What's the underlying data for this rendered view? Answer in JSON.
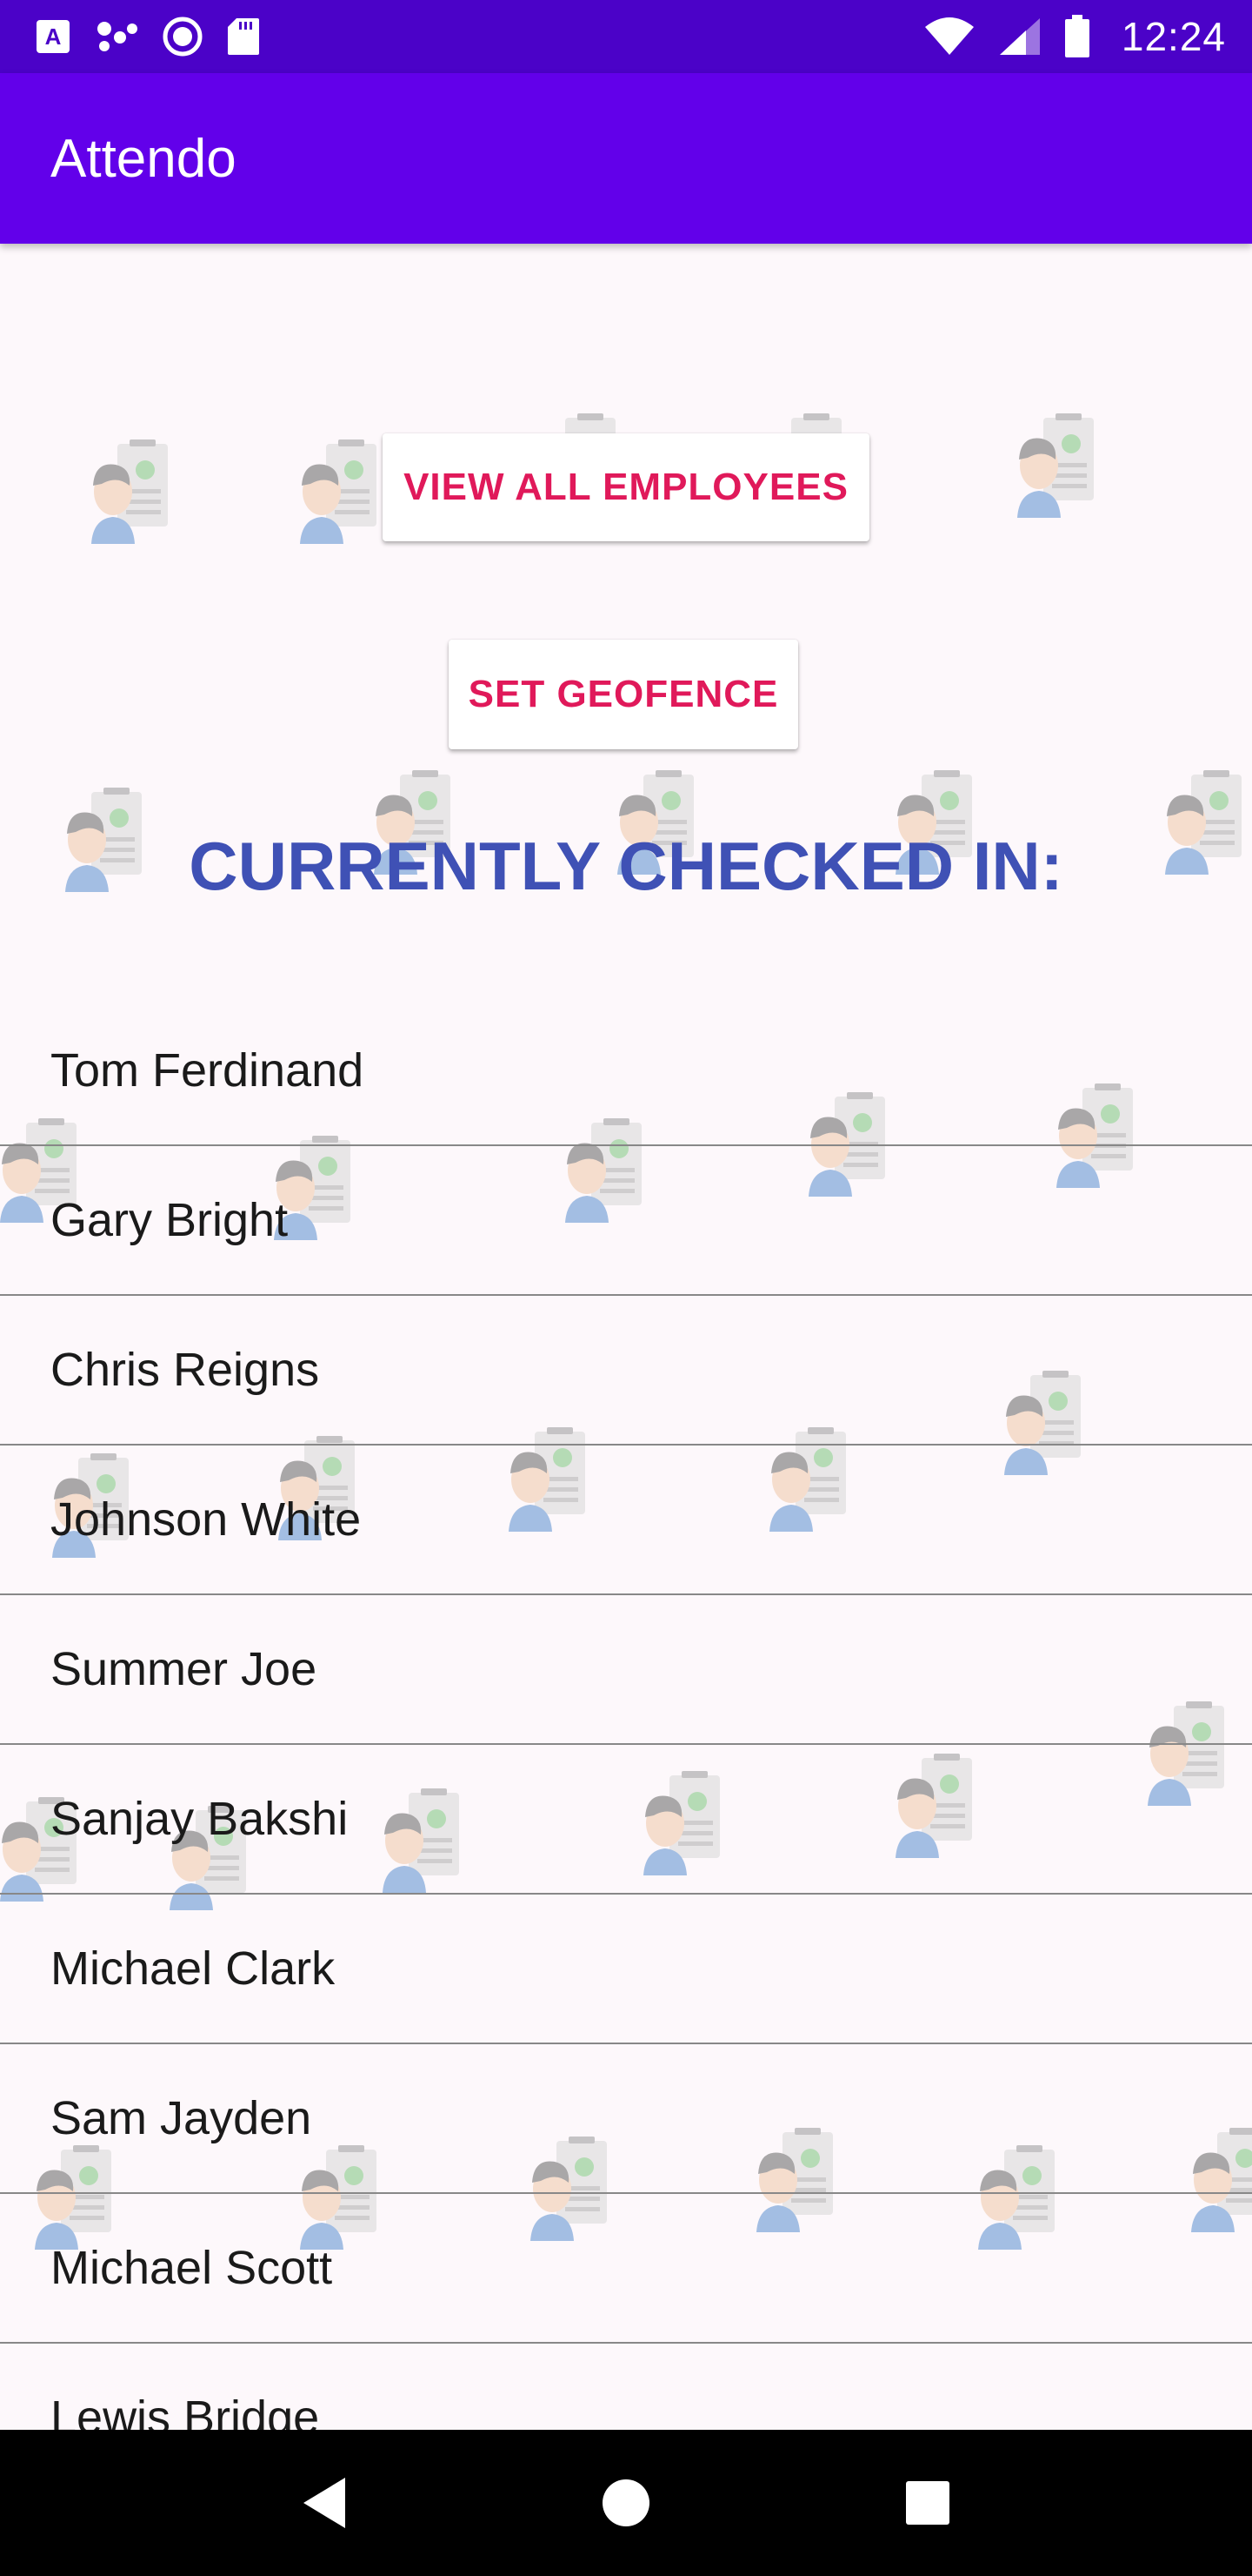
{
  "status_bar": {
    "time": "12:24",
    "icons": [
      "keyboard-a-icon",
      "share-dots-icon",
      "circle-record-icon",
      "sd-card-icon",
      "wifi-icon",
      "signal-icon",
      "battery-icon"
    ]
  },
  "app_bar": {
    "title": "Attendo",
    "color": "#6200ea"
  },
  "actions": {
    "view_all_label": "VIEW ALL EMPLOYEES",
    "set_geofence_label": "SET GEOFENCE",
    "accent_color": "#e0195a"
  },
  "section": {
    "title": "CURRENTLY CHECKED IN:",
    "color": "#3f51b5"
  },
  "checked_in": [
    "Tom Ferdinand",
    "Gary Bright",
    "Chris Reigns",
    "Johnson White",
    "Summer Joe",
    "Sanjay Bakshi",
    "Michael Clark",
    "Sam Jayden",
    "Michael Scott",
    "Lewis Bridge"
  ],
  "nav_bar": {
    "icons": [
      "back-icon",
      "home-icon",
      "recents-icon"
    ]
  }
}
